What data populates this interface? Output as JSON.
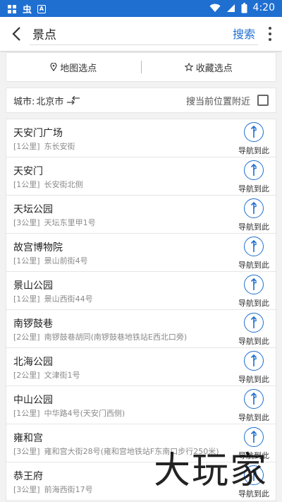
{
  "statusbar": {
    "app_glyph": "虫",
    "box_glyph": "A",
    "time": "4:20"
  },
  "topbar": {
    "search_value": "景点",
    "search_button": "搜索"
  },
  "pick": {
    "map_pick": "地图选点",
    "fav_pick": "收藏选点"
  },
  "city": {
    "label": "城市:",
    "name": "北京市",
    "nearby": "搜当前位置附近"
  },
  "nav_label": "导航到此",
  "places": [
    {
      "name": "天安门广场",
      "distance": "[1公里]",
      "address": "东长安街"
    },
    {
      "name": "天安门",
      "distance": "[1公里]",
      "address": "长安街北侧"
    },
    {
      "name": "天坛公园",
      "distance": "[3公里]",
      "address": "天坛东里甲1号"
    },
    {
      "name": "故宫博物院",
      "distance": "[1公里]",
      "address": "景山前街4号"
    },
    {
      "name": "景山公园",
      "distance": "[1公里]",
      "address": "景山西街44号"
    },
    {
      "name": "南锣鼓巷",
      "distance": "[2公里]",
      "address": "南锣鼓巷胡同(南锣鼓巷地铁站E西北口旁)"
    },
    {
      "name": "北海公园",
      "distance": "[2公里]",
      "address": "文津街1号"
    },
    {
      "name": "中山公园",
      "distance": "[1公里]",
      "address": "中华路4号(天安门西侧)"
    },
    {
      "name": "雍和宫",
      "distance": "[3公里]",
      "address": "雍和宫大街28号(雍和宫地铁站F东南口步行250米)"
    },
    {
      "name": "恭王府",
      "distance": "[3公里]",
      "address": "前海西街17号"
    }
  ],
  "watermark": "大玩家",
  "colors": {
    "accent": "#1f6fd1"
  }
}
